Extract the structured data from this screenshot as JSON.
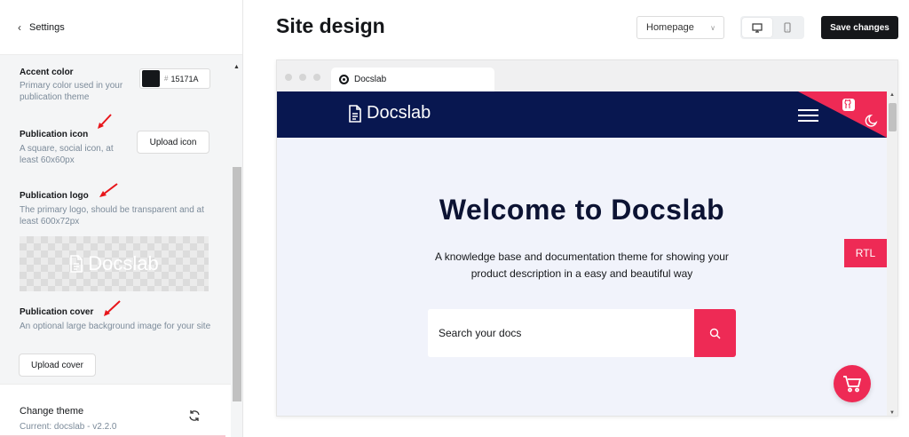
{
  "sidebar": {
    "back_label": "Settings",
    "accent": {
      "title": "Accent color",
      "desc": "Primary color used in your publication theme",
      "hash": "#",
      "value": "15171A",
      "swatch_color": "#15171a"
    },
    "icon": {
      "title": "Publication icon",
      "desc": "A square, social icon, at least 60x60px",
      "button": "Upload icon"
    },
    "logo": {
      "title": "Publication logo",
      "desc": "The primary logo, should be transparent and at least 600x72px",
      "preview_text": "Docslab"
    },
    "cover": {
      "title": "Publication cover",
      "desc": "An optional large background image for your site",
      "button": "Upload cover"
    },
    "theme": {
      "title": "Change theme",
      "current": "Current: docslab - v2.2.0"
    }
  },
  "header": {
    "title": "Site design",
    "page_select": "Homepage",
    "save_label": "Save changes"
  },
  "preview": {
    "tab_title": "Docslab",
    "site_logo": "Docslab",
    "heading": "Welcome to Docslab",
    "description": "A knowledge base and documentation theme for showing your product description in a easy and beautiful way",
    "rtl_label": "RTL",
    "search_placeholder": "Search your docs",
    "colors": {
      "nav": "#081750",
      "accent": "#ee2a55"
    }
  },
  "icons": {
    "back": "chevron-left-icon",
    "desktop": "desktop-icon",
    "mobile": "mobile-icon",
    "refresh": "refresh-icon",
    "github": "github-icon",
    "moon": "moon-icon",
    "search": "search-icon",
    "cart": "cart-icon",
    "document": "document-icon"
  }
}
